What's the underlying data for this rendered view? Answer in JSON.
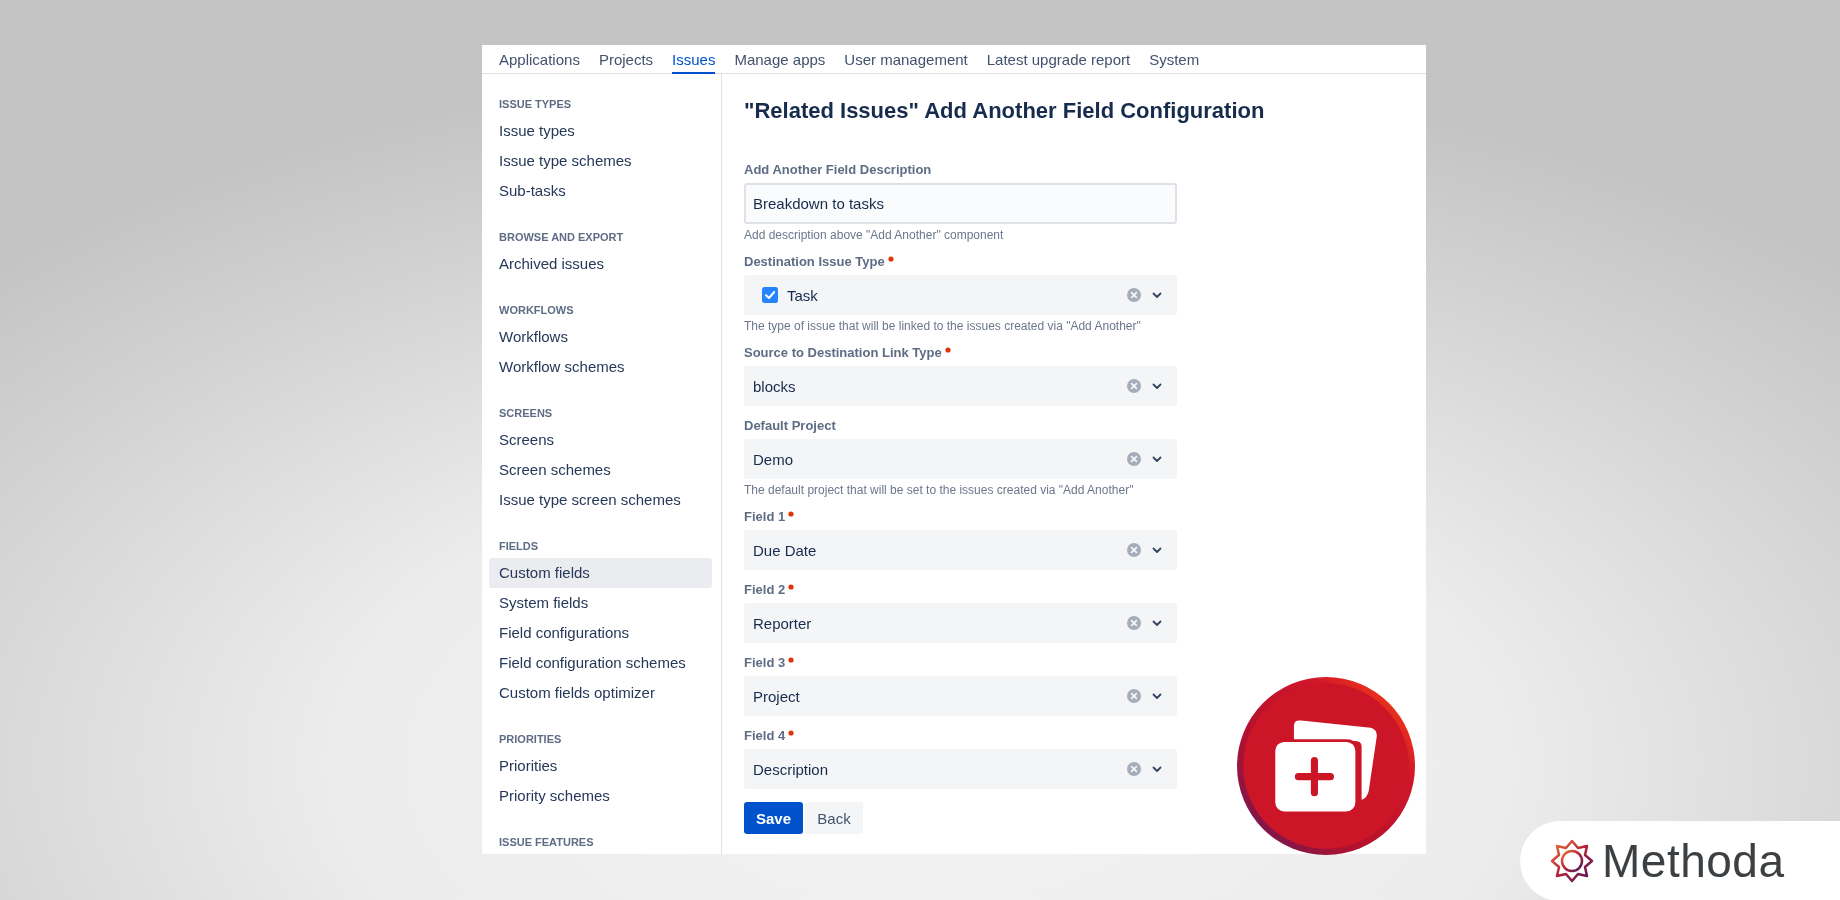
{
  "nav": {
    "tabs": [
      {
        "label": "Applications",
        "selected": false
      },
      {
        "label": "Projects",
        "selected": false
      },
      {
        "label": "Issues",
        "selected": true
      },
      {
        "label": "Manage apps",
        "selected": false
      },
      {
        "label": "User management",
        "selected": false
      },
      {
        "label": "Latest upgrade report",
        "selected": false
      },
      {
        "label": "System",
        "selected": false
      }
    ]
  },
  "sidebar": {
    "sections": [
      {
        "heading": "ISSUE TYPES",
        "items": [
          {
            "label": "Issue types",
            "selected": false
          },
          {
            "label": "Issue type schemes",
            "selected": false
          },
          {
            "label": "Sub-tasks",
            "selected": false
          }
        ]
      },
      {
        "heading": "BROWSE AND EXPORT",
        "items": [
          {
            "label": "Archived issues",
            "selected": false
          }
        ]
      },
      {
        "heading": "WORKFLOWS",
        "items": [
          {
            "label": "Workflows",
            "selected": false
          },
          {
            "label": "Workflow schemes",
            "selected": false
          }
        ]
      },
      {
        "heading": "SCREENS",
        "items": [
          {
            "label": "Screens",
            "selected": false
          },
          {
            "label": "Screen schemes",
            "selected": false
          },
          {
            "label": "Issue type screen schemes",
            "selected": false
          }
        ]
      },
      {
        "heading": "FIELDS",
        "items": [
          {
            "label": "Custom fields",
            "selected": true
          },
          {
            "label": "System fields",
            "selected": false
          },
          {
            "label": "Field configurations",
            "selected": false
          },
          {
            "label": "Field configuration schemes",
            "selected": false
          },
          {
            "label": "Custom fields optimizer",
            "selected": false
          }
        ]
      },
      {
        "heading": "PRIORITIES",
        "items": [
          {
            "label": "Priorities",
            "selected": false
          },
          {
            "label": "Priority schemes",
            "selected": false
          }
        ]
      },
      {
        "heading": "ISSUE FEATURES"
      }
    ]
  },
  "page_title": "\"Related Issues\" Add Another Field Configuration",
  "form": {
    "fields": [
      {
        "kind": "text",
        "label": "Add Another Field Description",
        "required": false,
        "value": "Breakdown to tasks",
        "hint": "Add description above \"Add Another\" component"
      },
      {
        "kind": "issue-type",
        "label": "Destination Issue Type",
        "required": true,
        "value": "Task",
        "hint": "The type of issue that will be linked to the issues created via \"Add Another\""
      },
      {
        "kind": "select",
        "label": "Source to Destination Link Type",
        "required": true,
        "value": "blocks"
      },
      {
        "kind": "select",
        "label": "Default Project",
        "required": false,
        "value": "Demo",
        "hint": "The default project that will be set to the issues created via \"Add Another\""
      },
      {
        "kind": "select",
        "label": "Field 1",
        "required": true,
        "value": "Due Date"
      },
      {
        "kind": "select",
        "label": "Field 2",
        "required": true,
        "value": "Reporter"
      },
      {
        "kind": "select",
        "label": "Field 3",
        "required": true,
        "value": "Project"
      },
      {
        "kind": "select",
        "label": "Field 4",
        "required": true,
        "value": "Description"
      }
    ],
    "buttons": [
      {
        "kind": "primary",
        "label": "Save"
      },
      {
        "kind": "subtle",
        "label": "Back"
      }
    ]
  },
  "brand": {
    "name": "Methoda"
  }
}
